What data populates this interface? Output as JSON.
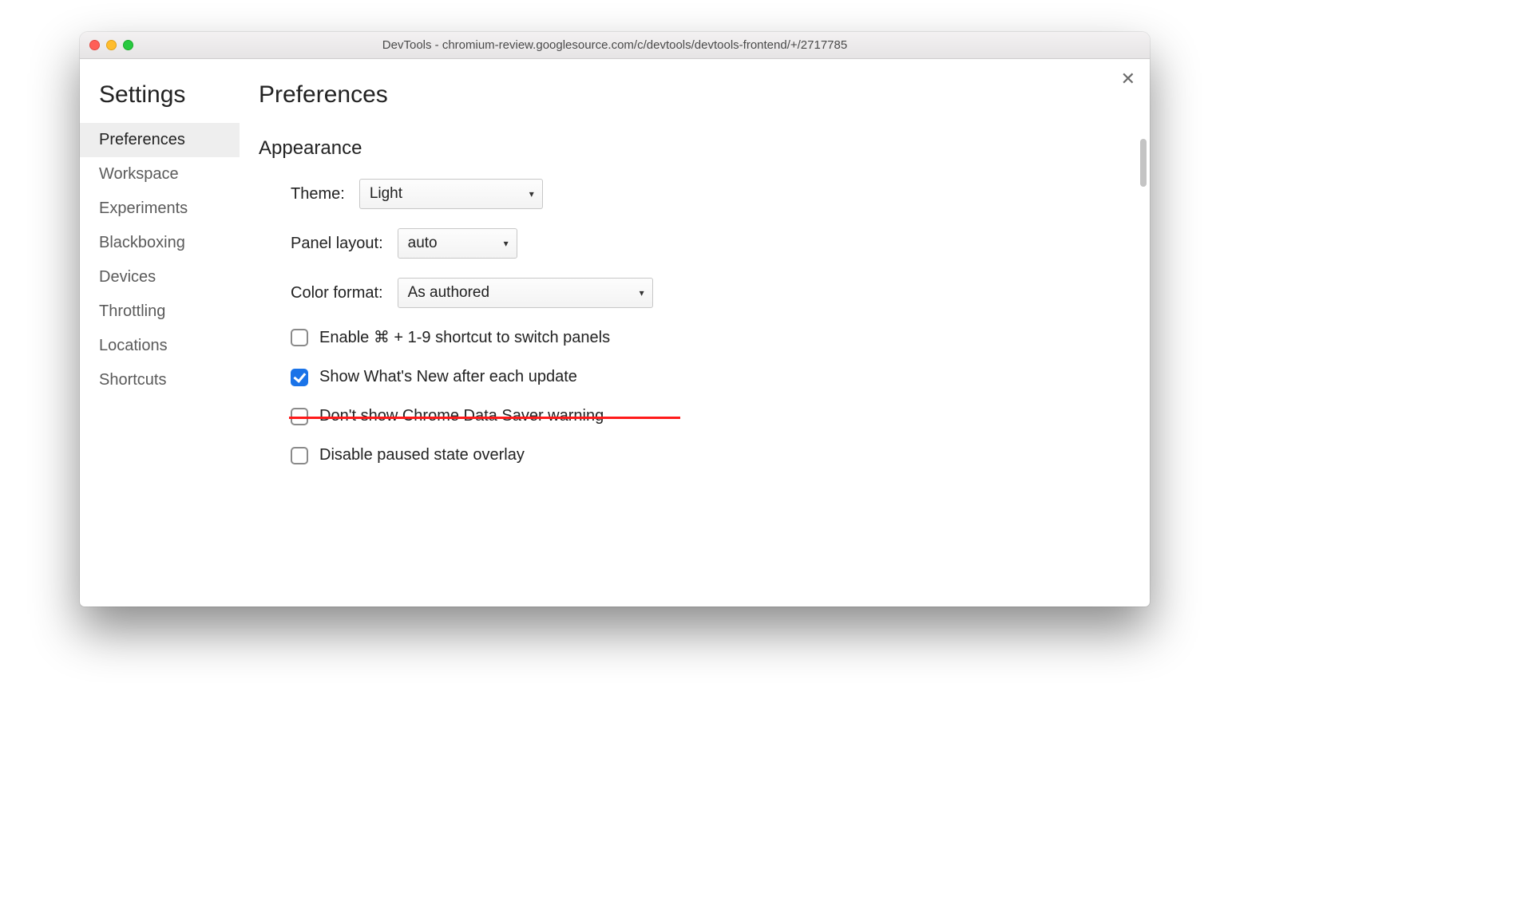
{
  "window": {
    "title": "DevTools - chromium-review.googlesource.com/c/devtools/devtools-frontend/+/2717785"
  },
  "sidebar": {
    "title": "Settings",
    "items": [
      {
        "label": "Preferences",
        "active": true
      },
      {
        "label": "Workspace",
        "active": false
      },
      {
        "label": "Experiments",
        "active": false
      },
      {
        "label": "Blackboxing",
        "active": false
      },
      {
        "label": "Devices",
        "active": false
      },
      {
        "label": "Throttling",
        "active": false
      },
      {
        "label": "Locations",
        "active": false
      },
      {
        "label": "Shortcuts",
        "active": false
      }
    ]
  },
  "main": {
    "title": "Preferences",
    "section": "Appearance",
    "theme_label": "Theme:",
    "theme_value": "Light",
    "layout_label": "Panel layout:",
    "layout_value": "auto",
    "color_label": "Color format:",
    "color_value": "As authored",
    "check_shortcut": "Enable ⌘ + 1-9 shortcut to switch panels",
    "check_whatsnew": "Show What's New after each update",
    "check_datasaver": "Don't show Chrome Data Saver warning",
    "check_overlay": "Disable paused state overlay"
  },
  "close_glyph": "✕"
}
